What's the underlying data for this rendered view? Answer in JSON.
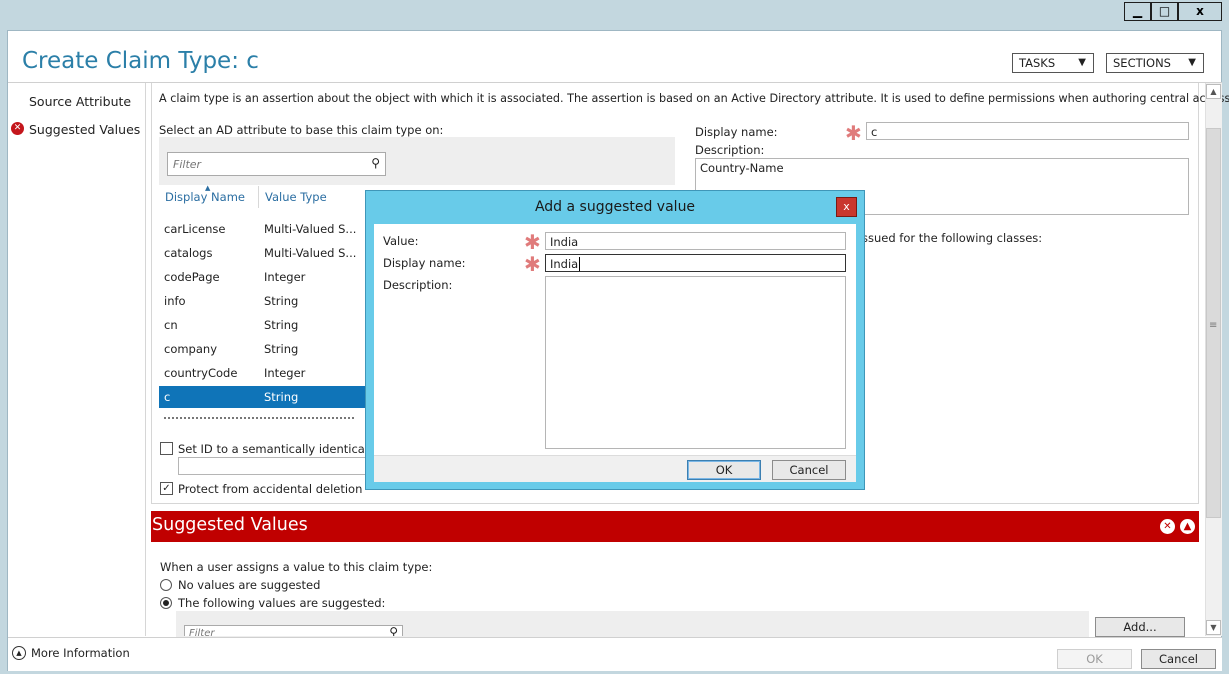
{
  "window": {
    "controls": {
      "minimize": "▁",
      "maximize": "□",
      "close": "x"
    }
  },
  "header": {
    "title": "Create Claim Type: c",
    "tasks_label": "TASKS",
    "sections_label": "SECTIONS"
  },
  "nav": {
    "items": [
      {
        "label": "Source Attribute",
        "error": false
      },
      {
        "label": "Suggested Values",
        "error": true
      }
    ]
  },
  "source": {
    "description": "A claim type is an assertion about the object with which it is associated. The assertion is based on an Active Directory attribute. It is used to define permissions when authoring central access rules.",
    "select_label": "Select an AD attribute to base this claim type on:",
    "filter_placeholder": "Filter",
    "columns": [
      "Display Name",
      "Value Type"
    ],
    "rows": [
      {
        "name": "carLicense",
        "type": "Multi-Valued S...",
        "selected": false
      },
      {
        "name": "catalogs",
        "type": "Multi-Valued S...",
        "selected": false
      },
      {
        "name": "codePage",
        "type": "Integer",
        "selected": false
      },
      {
        "name": "info",
        "type": "String",
        "selected": false
      },
      {
        "name": "cn",
        "type": "String",
        "selected": false
      },
      {
        "name": "company",
        "type": "String",
        "selected": false
      },
      {
        "name": "countryCode",
        "type": "Integer",
        "selected": false
      },
      {
        "name": "c",
        "type": "String",
        "selected": true
      }
    ],
    "set_id_label": "Set ID to a semantically identical cla",
    "protect_label": "Protect from accidental deletion",
    "display_name_label": "Display name:",
    "display_name_value": "c",
    "description_label": "Description:",
    "description_value": "Country-Name",
    "issued_text": "ssued for the following classes:"
  },
  "suggested": {
    "title": "Suggested Values",
    "intro": "When a user assigns a value to this claim type:",
    "option_none": "No values are suggested",
    "option_following": "The following values are suggested:",
    "filter_placeholder": "Filter",
    "add_label": "Add..."
  },
  "dialog": {
    "title": "Add a suggested value",
    "value_label": "Value:",
    "value": "India",
    "display_name_label": "Display name:",
    "display_name": "India",
    "description_label": "Description:",
    "ok_label": "OK",
    "cancel_label": "Cancel",
    "close": "x"
  },
  "footer": {
    "more_info": "More Information",
    "ok_label": "OK",
    "cancel_label": "Cancel"
  },
  "colors": {
    "accent_title": "#2b7fa8",
    "section_red": "#c00000",
    "selection_blue": "#0f74b8",
    "dialog_frame": "#68cbe9",
    "error_red": "#c4161c"
  }
}
